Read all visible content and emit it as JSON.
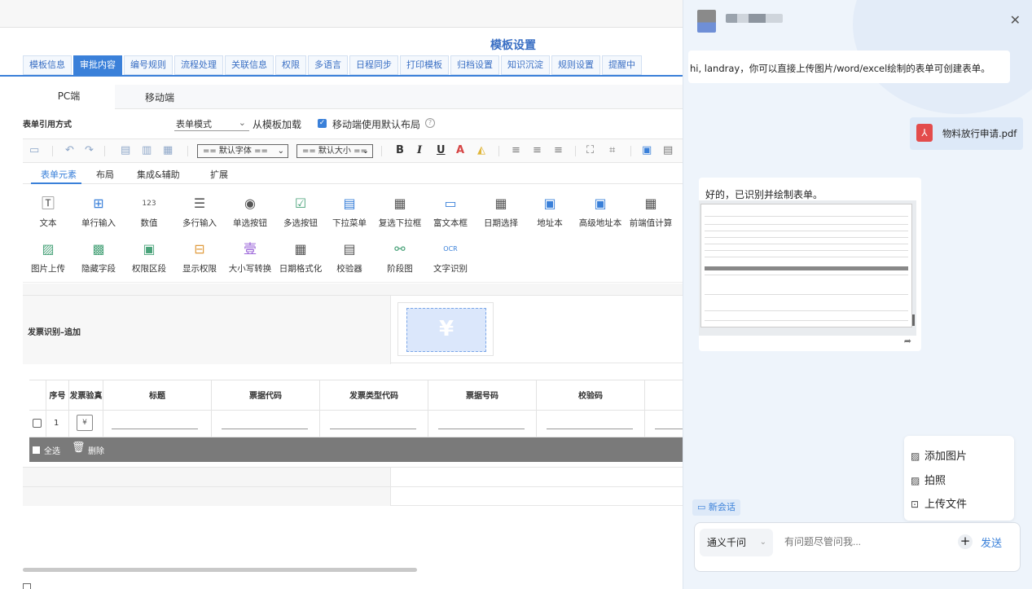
{
  "editor": {
    "page_title": "模板设置",
    "tabs": [
      "模板信息",
      "审批内容",
      "编号规则",
      "流程处理",
      "关联信息",
      "权限",
      "多语言",
      "日程同步",
      "打印模板",
      "归档设置",
      "知识沉淀",
      "规则设置",
      "提醒中"
    ],
    "active_tab_index": 1,
    "modes": {
      "pc": "PC端",
      "mobile": "移动端"
    },
    "form_ref": {
      "label": "表单引用方式",
      "select_value": "表单模式",
      "load_template": "从模板加载",
      "mobile_default_checked": true,
      "mobile_default_label": "移动端使用默认布局"
    },
    "toolbar": {
      "font_select": "== 默认字体 ==",
      "size_select": "== 默认大小 =="
    },
    "element_tabs": [
      "表单元素",
      "布局",
      "集成&辅助",
      "扩展"
    ],
    "elements_row1": [
      "文本",
      "单行输入",
      "数值",
      "多行输入",
      "单选按钮",
      "多选按钮",
      "下拉菜单",
      "复选下拉框",
      "富文本框",
      "日期选择",
      "地址本",
      "高级地址本",
      "前端值计算"
    ],
    "elements_row2": [
      "图片上传",
      "隐藏字段",
      "权限区段",
      "显示权限",
      "大小写转换",
      "日期格式化",
      "校验器",
      "阶段图",
      "文字识别"
    ],
    "invoice_label": "发票识别–追加",
    "table": {
      "headers": [
        "序号",
        "发票验真",
        "标题",
        "票据代码",
        "发票类型代码",
        "票据号码",
        "校验码"
      ],
      "row_number": "1"
    },
    "footer": {
      "select_all": "全选",
      "delete": "删除"
    }
  },
  "chat": {
    "messages": {
      "greeting": "hi, landray，你可以直接上传图片/word/excel绘制的表单可创建表单。",
      "file_name": "物料放行申请.pdf",
      "reply": "好的，已识别并绘制表单。"
    },
    "menu": [
      "添加图片",
      "拍照",
      "上传文件"
    ],
    "new_chat": "新会话",
    "model": "通义千问",
    "input_placeholder": "有问题尽管问我...",
    "send": "发送"
  },
  "colors": {
    "accent": "#3a80d9",
    "panel_bg": "#eef4fb"
  }
}
